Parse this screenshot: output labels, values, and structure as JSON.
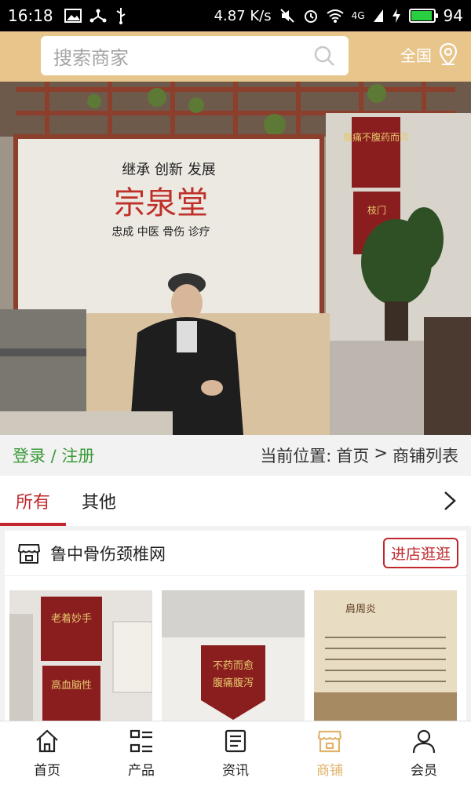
{
  "status_bar": {
    "time": "16:18",
    "speed": "4.87 K/s",
    "network": "4G",
    "battery": "94"
  },
  "header": {
    "search_placeholder": "搜索商家",
    "region": "全国"
  },
  "banner": {
    "sign_top": "继承 创新 发展",
    "sign_main": "宗泉堂",
    "sign_bottom": "忠成 中医 骨伤 诊疗",
    "banner_right_1": "腹痛不腹药而泻",
    "banner_right_2": "枝门"
  },
  "infobar": {
    "login_label": "登录 / 注册",
    "location_label": "当前位置:",
    "home": "首页",
    "separator": ">",
    "current": "商铺列表"
  },
  "tabs": [
    {
      "label": "所有",
      "active": true
    },
    {
      "label": "其他",
      "active": false
    }
  ],
  "shop": {
    "name": "鲁中骨伤颈椎网",
    "visit_label": "进店逛逛",
    "thumb_texts": {
      "t1_line1": "老着妙手",
      "t1_line2": "高血脑性",
      "t2_line1": "不药而愈",
      "t2_line2": "腹痛腹泻",
      "t3_title": "肩周炎"
    }
  },
  "bottom_nav": [
    {
      "label": "首页",
      "icon": "home-icon",
      "active": false
    },
    {
      "label": "产品",
      "icon": "grid-icon",
      "active": false
    },
    {
      "label": "资讯",
      "icon": "news-icon",
      "active": false
    },
    {
      "label": "商铺",
      "icon": "shop-icon",
      "active": true
    },
    {
      "label": "会员",
      "icon": "user-icon",
      "active": false
    }
  ],
  "colors": {
    "accent": "#c1272d",
    "header_bg": "#e7c58b",
    "login_green": "#3a9a3a",
    "nav_active": "#e0b46c"
  }
}
